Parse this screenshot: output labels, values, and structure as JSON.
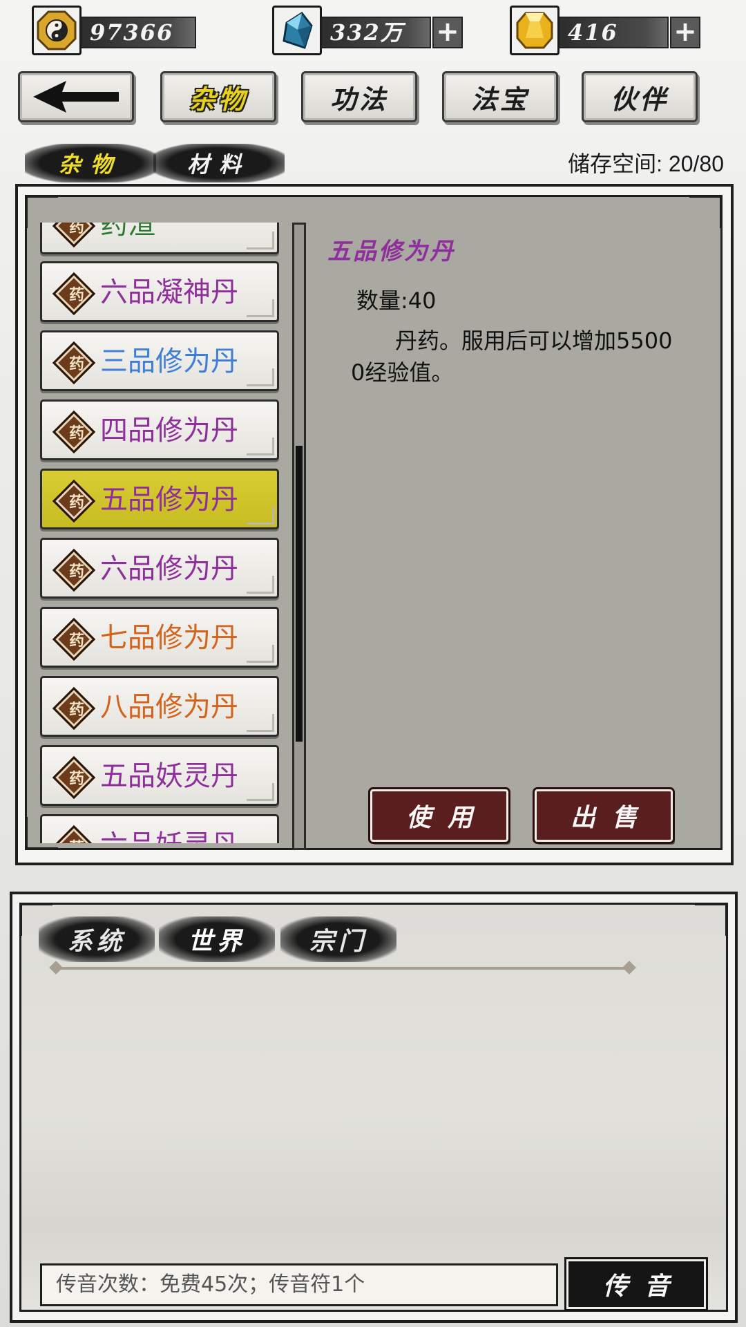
{
  "currency": [
    {
      "name": "yinyang-coin",
      "value": "97366",
      "has_plus": false
    },
    {
      "name": "spirit-stone",
      "value": "332万",
      "has_plus": true
    },
    {
      "name": "gold-gem",
      "value": "416",
      "has_plus": true
    }
  ],
  "nav": {
    "back_icon": "arrow-left-icon",
    "tabs": [
      "杂物",
      "功法",
      "法宝",
      "伙伴"
    ],
    "active_tab": "杂物"
  },
  "subtabs": {
    "items": [
      "杂物",
      "材料"
    ],
    "active": "杂物"
  },
  "storage": "储存空间: 20/80",
  "item_tag": "药",
  "items": [
    {
      "name": "药渣",
      "color": "#2f7a33"
    },
    {
      "name": "六品凝神丹",
      "color": "#8e2f9c"
    },
    {
      "name": "三品修为丹",
      "color": "#3f7fd6"
    },
    {
      "name": "四品修为丹",
      "color": "#8e2f9c"
    },
    {
      "name": "五品修为丹",
      "color": "#8e2f9c"
    },
    {
      "name": "六品修为丹",
      "color": "#8e2f9c"
    },
    {
      "name": "七品修为丹",
      "color": "#d4631e"
    },
    {
      "name": "八品修为丹",
      "color": "#d4631e"
    },
    {
      "name": "五品妖灵丹",
      "color": "#8e2f9c"
    },
    {
      "name": "六品妖灵丹",
      "color": "#8e2f9c"
    }
  ],
  "selected_index": 4,
  "detail": {
    "title": "五品修为丹",
    "quantity": "数量:40",
    "description": "丹药。服用后可以增加55000经验值。"
  },
  "buttons": {
    "use": "使用",
    "sell": "出售"
  },
  "chat": {
    "tabs": [
      "系统",
      "世界",
      "宗门"
    ],
    "active_tab": "世界",
    "input_text": "传音次数：免费45次；传音符1个",
    "send": "传音"
  }
}
